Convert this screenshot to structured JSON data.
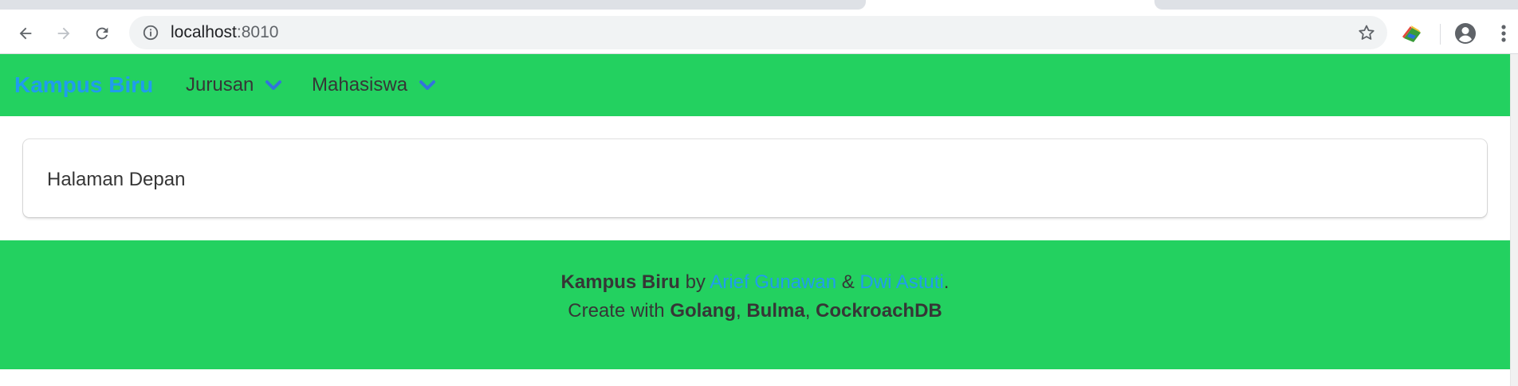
{
  "browser": {
    "url_host": "localhost",
    "url_port": ":8010"
  },
  "navbar": {
    "brand": "Kampus Biru",
    "menus": [
      {
        "label": "Jurusan"
      },
      {
        "label": "Mahasiswa"
      }
    ]
  },
  "main": {
    "box_text": "Halaman Depan"
  },
  "footer": {
    "line1": {
      "brand": "Kampus Biru",
      "by": "by",
      "author1": "Arief Gunawan",
      "amp": "&",
      "author2": "Dwi Astuti",
      "end": "."
    },
    "line2": {
      "prefix": "Create with",
      "tech1": "Golang",
      "sep1": ",",
      "tech2": "Bulma",
      "sep2": ",",
      "tech3": "CockroachDB"
    }
  },
  "colors": {
    "primary_green": "#23d160",
    "link_blue": "#209cee",
    "text_dark": "#363636"
  }
}
